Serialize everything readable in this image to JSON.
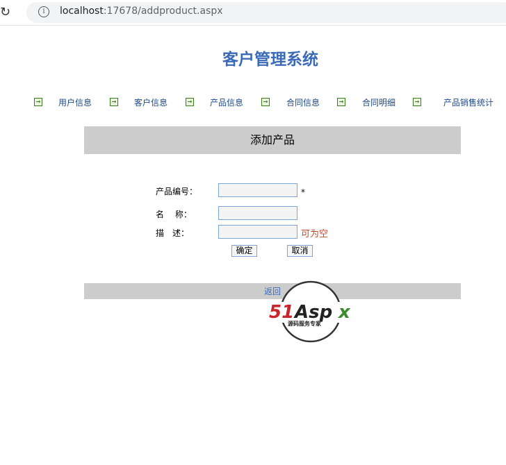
{
  "browser": {
    "url_host": "localhost",
    "url_rest": ":17678/addproduct.aspx"
  },
  "page": {
    "title": "客户管理系统"
  },
  "nav": {
    "items": [
      {
        "label": "用户信息"
      },
      {
        "label": "客户信息"
      },
      {
        "label": "产品信息"
      },
      {
        "label": "合同信息"
      },
      {
        "label": "合同明细"
      },
      {
        "label": "产品销售统计"
      }
    ]
  },
  "form": {
    "heading": "添加产品",
    "code_label": "产品编号：",
    "code_value": "",
    "required_mark": "*",
    "name_label": "名　 称：",
    "name_value": "",
    "desc_label": "描　述：",
    "desc_value": "",
    "optional_note": "可为空",
    "ok_label": "确定",
    "cancel_label": "取消"
  },
  "footer": {
    "back_label": "返回"
  },
  "watermark": {
    "brand": "51Aspx",
    "tagline": "源码服务专家"
  },
  "colors": {
    "title": "#3a6ab8",
    "nav_link": "#1f4a87",
    "bar_bg": "#cccccc",
    "optional_note": "#c24a2a",
    "icon_green": "#3b7a1f"
  }
}
